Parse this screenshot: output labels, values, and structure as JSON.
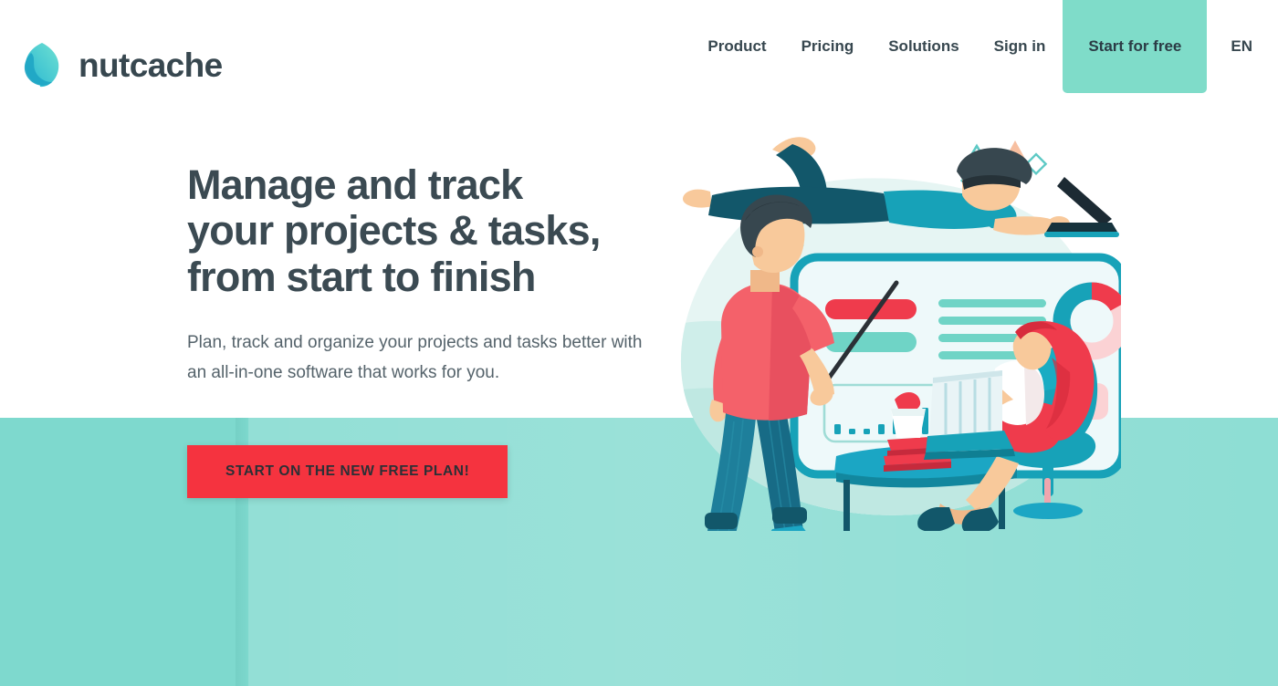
{
  "brand": {
    "name": "nutcache",
    "logo_icon": "nutcache-leaf-logo-icon",
    "logo_color_start": "#33c3d6",
    "logo_color_end": "#5fd9cf"
  },
  "header": {
    "nav_items": [
      {
        "label": "Product",
        "name": "nav-product"
      },
      {
        "label": "Pricing",
        "name": "nav-pricing"
      },
      {
        "label": "Solutions",
        "name": "nav-solutions"
      },
      {
        "label": "Sign in",
        "name": "nav-sign-in"
      }
    ],
    "cta": {
      "label": "Start for free",
      "bg": "#7fdcc9"
    },
    "language": {
      "label": "EN"
    }
  },
  "hero": {
    "title_line1": "Manage and track",
    "title_line2": "your projects & tasks,",
    "title_line3": "from start to finish",
    "subtitle": "Plan, track and organize your projects and tasks better with an all-in-one software that works for you.",
    "cta_label": "START ON THE NEW FREE PLAN!",
    "cta_bg": "#f5333f",
    "cta_text_color": "#2b3036",
    "title_color": "#3b4a52",
    "band_color": "#7ed9ce"
  },
  "illustration": {
    "name": "team-project-dashboard-illustration",
    "alt": "Three people working with a large project dashboard board",
    "palette": {
      "teal": "#17a2b8",
      "teal_dark": "#0f7f93",
      "mint": "#7fd9cf",
      "mint_pale": "#d9f2ef",
      "red": "#ef3b4c",
      "coral": "#f4616a",
      "pink": "#fbd2d4",
      "skin": "#f8c99b",
      "navy": "#12576a",
      "dark": "#263238",
      "board_fill": "#eef9fa"
    },
    "board": {
      "bars": [
        {
          "color": "#ef3b4c",
          "width": 98
        },
        {
          "color": "#6fd4c6",
          "width": 98
        }
      ],
      "text_lines": 4,
      "donut_segments": [
        {
          "color": "#ef3b4c",
          "share": 0.17
        },
        {
          "color": "#fbd2d4",
          "share": 0.45
        },
        {
          "color": "#17a2b8",
          "share": 0.38
        }
      ],
      "chart_bars": [
        9,
        4,
        4,
        8,
        15,
        27,
        22,
        30,
        27,
        36
      ],
      "pink_block": "#fbd2d4"
    },
    "decor_shapes": [
      "triangle-outline-teal",
      "triangle-filled-peach",
      "dot-red",
      "diamond-outline-teal",
      "dot-mint",
      "square-outline-teal"
    ],
    "people": [
      {
        "name": "floating-man-with-laptop",
        "shirt": "#17a2b8",
        "pants": "#12576a",
        "hair": "#37474f"
      },
      {
        "name": "standing-man-with-pointer",
        "shirt": "#f4616a",
        "pants": "#1e7f9b",
        "hair": "#37474f"
      },
      {
        "name": "seated-woman-at-desk",
        "hair": "#ef3b4c",
        "chair": "#17a2b8",
        "skirt": "#ef3b4c"
      }
    ]
  }
}
